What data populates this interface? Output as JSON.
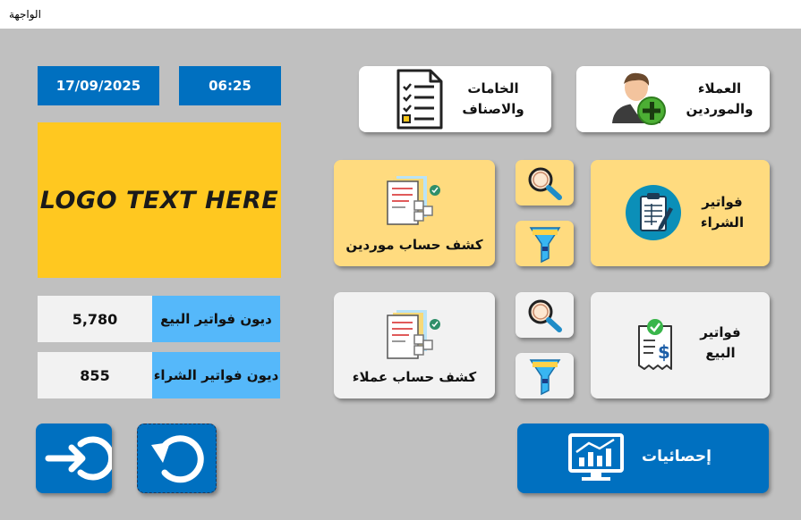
{
  "window": {
    "title": "الواجهة"
  },
  "header": {
    "date": "17/09/2025",
    "time": "06:25"
  },
  "logo": {
    "text": "LOGO TEXT HERE"
  },
  "debts": [
    {
      "label": "ديون فواتير البيع",
      "value": "5,780"
    },
    {
      "label": "ديون فواتير الشراء",
      "value": "855"
    }
  ],
  "buttons": {
    "customers_suppliers": {
      "line1": "العملاء",
      "line2": "والموردين"
    },
    "materials_items": {
      "line1": "الخامات",
      "line2": "والاصناف"
    },
    "purchase_invoices": {
      "line1": "فواتير",
      "line2": "الشراء"
    },
    "supplier_statement": {
      "label": "كشف حساب موردين"
    },
    "sales_invoices": {
      "line1": "فواتير",
      "line2": "البيع"
    },
    "customer_statement": {
      "label": "كشف حساب عملاء"
    },
    "statistics": {
      "label": "إحصائيات"
    }
  },
  "colors": {
    "accent_blue": "#0070c0",
    "yellow": "#ffdb7f",
    "logo_yellow": "#ffc820",
    "light_blue": "#55b8fa"
  }
}
